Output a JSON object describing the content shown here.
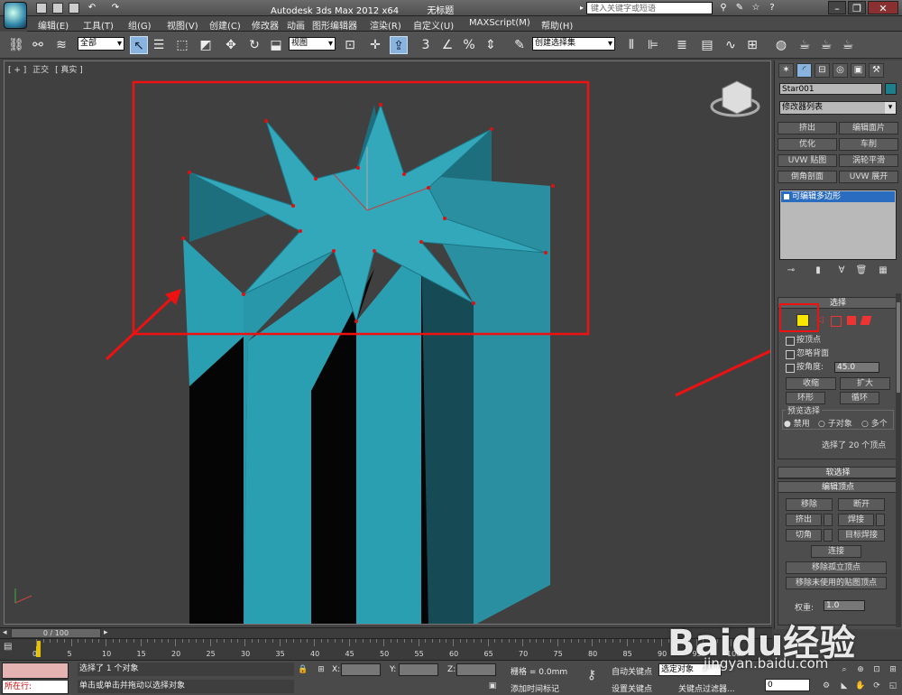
{
  "title": {
    "app": "Autodesk 3ds Max  2012 x64",
    "document": "无标题",
    "search_placeholder": "键入关键字或短语"
  },
  "menu": [
    "编辑(E)",
    "工具(T)",
    "组(G)",
    "视图(V)",
    "创建(C)",
    "修改器",
    "动画",
    "图形编辑器",
    "渲染(R)",
    "自定义(U)",
    "MAXScript(M)",
    "帮助(H)"
  ],
  "toolbar": {
    "selection_filter": "全部",
    "ref_coord": "视图",
    "named_selection": "创建选择集"
  },
  "viewport": {
    "labels": [
      "[ + ]",
      "正交",
      "[ 真实 ]"
    ]
  },
  "command_panel": {
    "object_name": "Star001",
    "object_color": "#1d7e8c",
    "modifier_list": "修改器列表",
    "modifier_buttons": [
      "挤出",
      "编辑面片",
      "优化",
      "车削",
      "UVW 贴图",
      "涡轮平滑",
      "倒角剖面",
      "UVW 展开"
    ],
    "stack_item": "可编辑多边形",
    "selection": {
      "title": "选择",
      "by_vertex": "按顶点",
      "ignore_backfacing": "忽略背面",
      "by_angle": "按角度:",
      "angle_value": "45.0",
      "shrink": "收缩",
      "grow": "扩大",
      "ring": "环形",
      "loop": "循环",
      "preview_title": "预览选择",
      "preview_options": [
        "禁用",
        "子对象",
        "多个"
      ],
      "status": "选择了 20 个顶点"
    },
    "soft_selection": "软选择",
    "edit_vertices": {
      "title": "编辑顶点",
      "remove": "移除",
      "break": "断开",
      "extrude": "挤出",
      "weld": "焊接",
      "chamfer": "切角",
      "target_weld": "目标焊接",
      "connect": "连接",
      "remove_isolated": "移除孤立顶点",
      "remove_unused": "移除未使用的贴图顶点",
      "weight_label": "权重:",
      "weight_value": "1.0"
    }
  },
  "timeline": {
    "frame": "0 / 100",
    "ticks": [
      "0",
      "5",
      "10",
      "15",
      "20",
      "25",
      "30",
      "35",
      "40",
      "45",
      "50",
      "55",
      "60",
      "65",
      "70",
      "75",
      "80",
      "85",
      "90",
      "95",
      "100"
    ]
  },
  "status": {
    "running": "所在行:",
    "line1": "选择了 1 个对象",
    "line2": "单击或单击并拖动以选择对象",
    "x_label": "X:",
    "y_label": "Y:",
    "z_label": "Z:",
    "grid": "栅格 = 0.0mm",
    "add_time_tag": "添加时间标记",
    "auto_key": "自动关键点",
    "selected": "选定对象",
    "set_key": "设置关键点",
    "key_filters": "关键点过滤器...",
    "frame_value": "0"
  },
  "watermark": {
    "text": "Baidu经验",
    "sub": "jingyan.baidu.com"
  },
  "colors": {
    "mesh": "#2a9fb2",
    "mesh_dark": "#1d6f7e",
    "annotation": "#ee1111",
    "selected_icon": "#f7e700"
  }
}
